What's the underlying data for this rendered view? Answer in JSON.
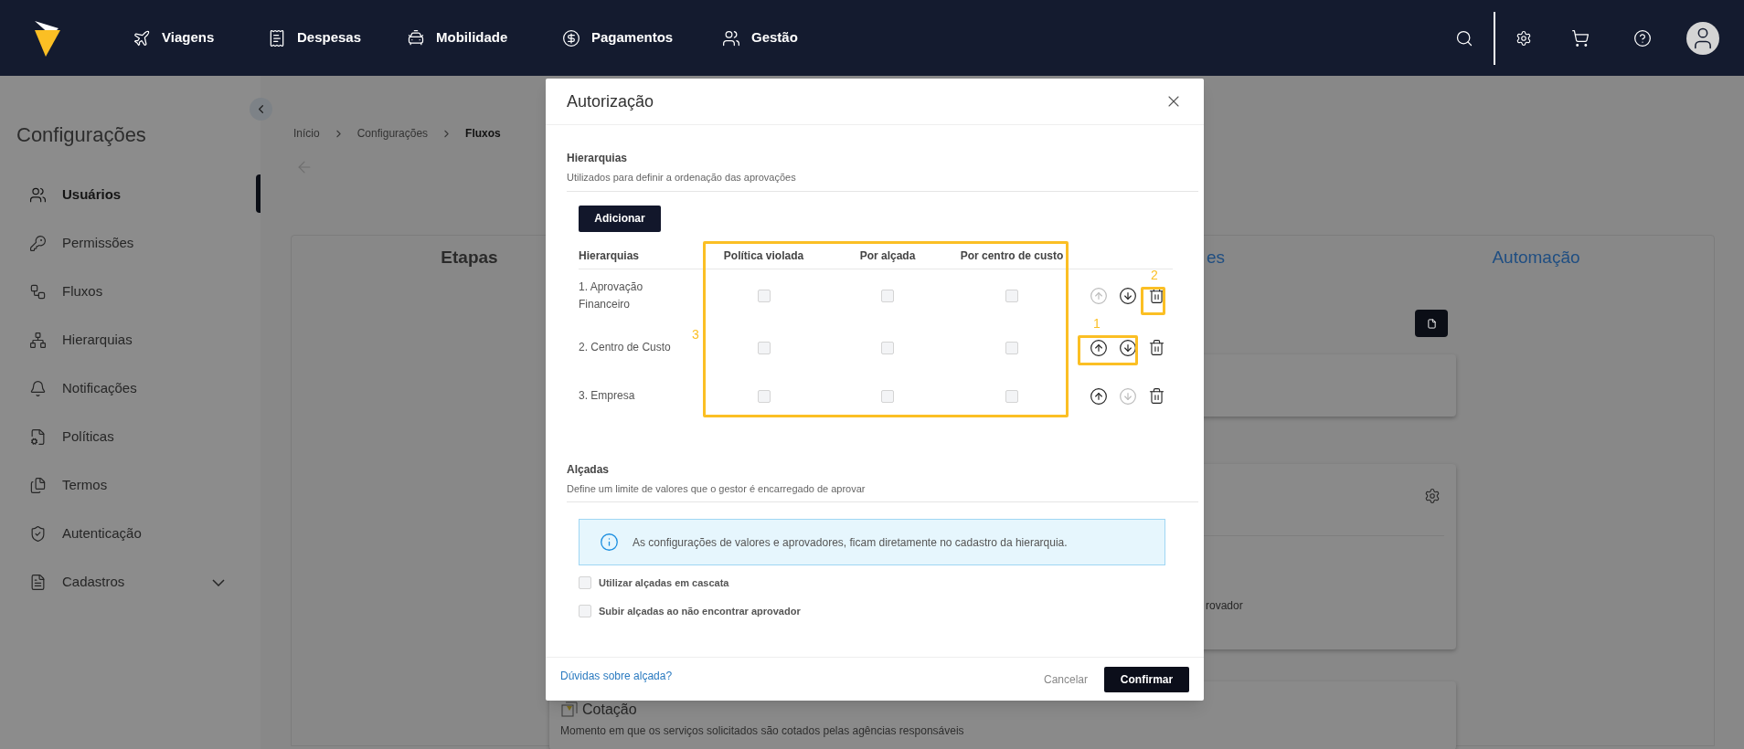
{
  "nav": {
    "items": [
      {
        "label": "Viagens"
      },
      {
        "label": "Despesas"
      },
      {
        "label": "Mobilidade"
      },
      {
        "label": "Pagamentos"
      },
      {
        "label": "Gestão"
      }
    ]
  },
  "sidebar": {
    "title": "Configurações",
    "items": [
      {
        "label": "Usuários",
        "kind": "link",
        "selected": true
      },
      {
        "label": "Permissões",
        "kind": "link",
        "selected": false
      },
      {
        "label": "Fluxos",
        "kind": "link",
        "selected": false
      },
      {
        "label": "Hierarquias",
        "kind": "link",
        "selected": false
      },
      {
        "label": "Notificações",
        "kind": "link",
        "selected": false
      },
      {
        "label": "Políticas",
        "kind": "link",
        "selected": false
      },
      {
        "label": "Termos",
        "kind": "link",
        "selected": false
      },
      {
        "label": "Autenticação",
        "kind": "link",
        "selected": false
      },
      {
        "label": "Cadastros",
        "kind": "group",
        "selected": false
      }
    ]
  },
  "breadcrumb": [
    "Início",
    "Configurações",
    "Fluxos"
  ],
  "tabs": [
    {
      "label": "Etapas",
      "selected": true
    },
    {
      "label": "es",
      "selected": false
    },
    {
      "label": "Automação",
      "selected": false
    }
  ],
  "background": {
    "fragment": "rovador",
    "card": {
      "title": "Cotação",
      "description": "Momento em que os serviços solicitados são cotados pelas agências responsáveis"
    }
  },
  "modal": {
    "title": "Autorização",
    "hierarquias": {
      "title": "Hierarquias",
      "subtitle": "Utilizados para definir a ordenação das aprovações",
      "add_button": "Adicionar",
      "columns": [
        "Hierarquias",
        "Política violada",
        "Por alçada",
        "Por centro de custo"
      ],
      "rows": [
        {
          "name": "1. Aprovação Financeiro",
          "checks": [
            false,
            false,
            false
          ],
          "up_disabled": true,
          "down_disabled": false
        },
        {
          "name": "2. Centro de Custo",
          "checks": [
            false,
            false,
            false
          ],
          "up_disabled": false,
          "down_disabled": false
        },
        {
          "name": "3. Empresa",
          "checks": [
            false,
            false,
            false
          ],
          "up_disabled": false,
          "down_disabled": true
        }
      ]
    },
    "alcadas": {
      "title": "Alçadas",
      "subtitle": "Define um limite de valores que o gestor é encarregado de aprovar",
      "info": "As configurações de valores e aprovadores, ficam diretamente no cadastro da hierarquia.",
      "options": [
        {
          "label": "Utilizar alçadas em cascata",
          "checked": false
        },
        {
          "label": "Subir alçadas ao não encontrar aprovador",
          "checked": false
        }
      ]
    },
    "help_link": "Dúvidas sobre alçada?",
    "cancel": "Cancelar",
    "confirm": "Confirmar"
  },
  "annotations": [
    {
      "label": "1"
    },
    {
      "label": "2"
    },
    {
      "label": "3"
    }
  ]
}
